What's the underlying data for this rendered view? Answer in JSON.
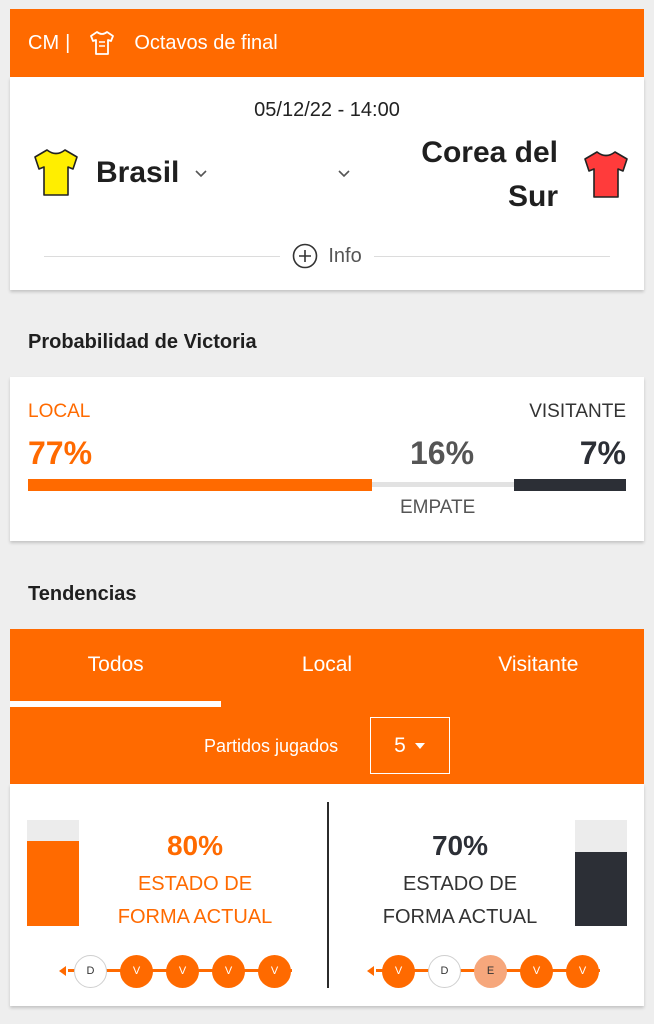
{
  "header": {
    "competition": "CM",
    "separator": "|",
    "stage": "Octavos de final"
  },
  "match": {
    "datetime": "05/12/22 - 14:00",
    "home": {
      "name": "Brasil",
      "color": "#ffee00"
    },
    "away": {
      "name": "Corea del Sur",
      "color": "#ff3b3b"
    },
    "info_label": "Info"
  },
  "probability": {
    "title": "Probabilidad de Victoria",
    "local_label": "LOCAL",
    "visitor_label": "VISITANTE",
    "draw_label": "EMPATE",
    "local_pct": "77%",
    "draw_pct": "16%",
    "visitor_pct": "7%"
  },
  "trends": {
    "title": "Tendencias",
    "tabs": [
      {
        "label": "Todos"
      },
      {
        "label": "Local"
      },
      {
        "label": "Visitante"
      }
    ],
    "active_tab": "Todos",
    "played_label": "Partidos jugados",
    "played_value": "5",
    "home": {
      "pct": "80%",
      "label_line1": "ESTADO DE",
      "label_line2": "FORMA ACTUAL",
      "fill_fraction": 0.8,
      "results": [
        "D",
        "V",
        "V",
        "V",
        "V"
      ]
    },
    "away": {
      "pct": "70%",
      "label_line1": "ESTADO DE",
      "label_line2": "FORMA ACTUAL",
      "fill_fraction": 0.7,
      "results": [
        "V",
        "D",
        "E",
        "V",
        "V"
      ]
    }
  },
  "colors": {
    "accent": "#ff6a00",
    "dark": "#2c2f36",
    "background": "#eeeeee"
  }
}
